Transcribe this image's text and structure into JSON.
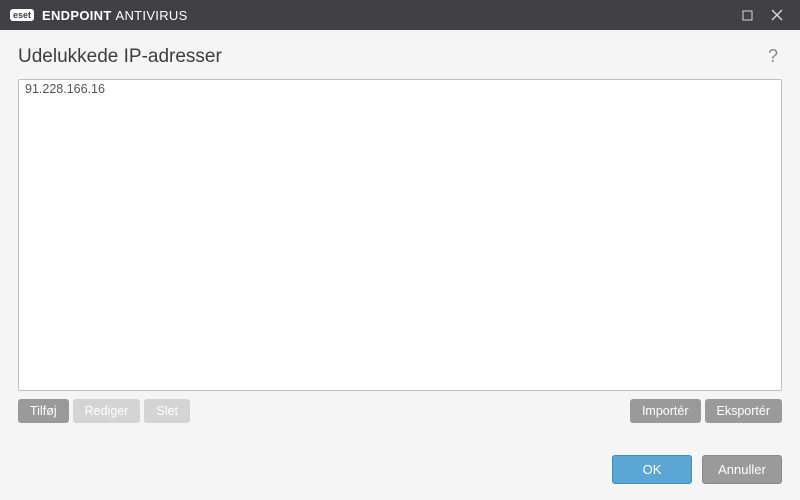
{
  "titlebar": {
    "brand_badge": "eset",
    "brand_strong": "ENDPOINT",
    "brand_light": "ANTIVIRUS"
  },
  "heading": "Udelukkede IP-adresser",
  "help_glyph": "?",
  "list": {
    "items": [
      "91.228.166.16"
    ]
  },
  "toolbar": {
    "add": "Tilføj",
    "edit": "Rediger",
    "delete": "Slet",
    "import": "Importér",
    "export": "Eksportér"
  },
  "footer": {
    "ok": "OK",
    "cancel": "Annuller"
  }
}
